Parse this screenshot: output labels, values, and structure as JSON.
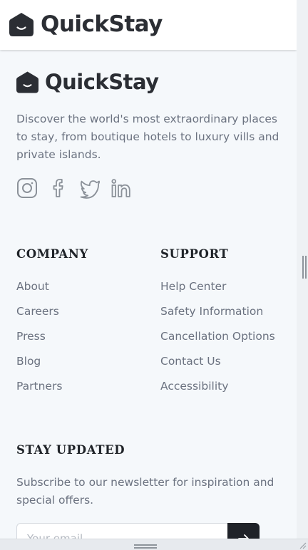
{
  "header": {
    "brand_name": "QuickStay",
    "logo_icon": "quickstay-logo-icon"
  },
  "footer": {
    "brand_name": "QuickStay",
    "description": "Discover the world's most extraordinary places to stay, from boutique hotels to luxury vills and private islands.",
    "socials": [
      "instagram-icon",
      "facebook-icon",
      "twitter-icon",
      "linkedin-icon"
    ],
    "company": {
      "title": "COMPANY",
      "links": [
        "About",
        "Careers",
        "Press",
        "Blog",
        "Partners"
      ]
    },
    "support": {
      "title": "SUPPORT",
      "links": [
        "Help Center",
        "Safety Information",
        "Cancellation Options",
        "Contact Us",
        "Accessibility"
      ]
    },
    "newsletter": {
      "title": "STAY UPDATED",
      "description": "Subscribe to our newsletter for inspiration and special offers.",
      "placeholder": "Your email",
      "submit_icon": "arrow-right-icon"
    }
  },
  "colors": {
    "page_background": "#f5f8fb",
    "brand_dark": "#2b2e34",
    "text_muted": "#6b7280",
    "button_dark": "#1f2228"
  }
}
